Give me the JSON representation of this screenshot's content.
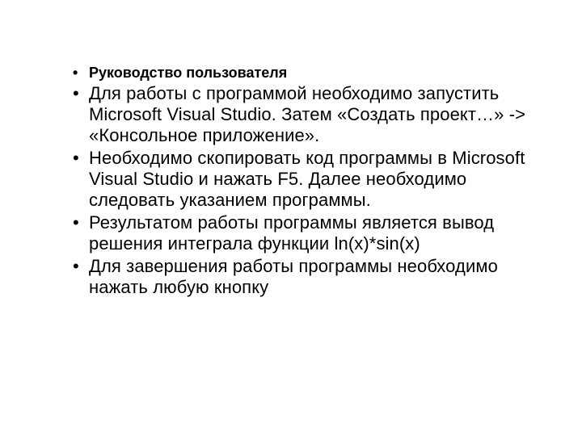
{
  "bullets": {
    "title": "Руководство пользователя",
    "items": [
      "Для работы с программой необходимо запустить Microsoft Visual Studio.  Затем «Создать проект…» -> «Консольное приложение».",
      "Необходимо скопировать  код программы в Microsoft Visual Studio и нажать F5. Далее необходимо следовать указанием программы.",
      "Результатом работы программы является вывод решения интеграла функции ln(x)*sin(x)",
      "Для завершения работы программы необходимо нажать любую кнопку"
    ]
  }
}
